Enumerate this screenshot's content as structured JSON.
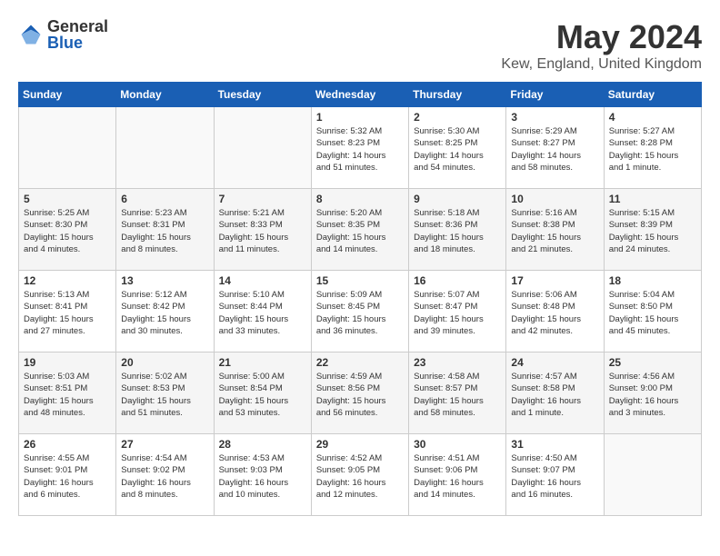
{
  "logo": {
    "general": "General",
    "blue": "Blue"
  },
  "title": {
    "month": "May 2024",
    "location": "Kew, England, United Kingdom"
  },
  "headers": [
    "Sunday",
    "Monday",
    "Tuesday",
    "Wednesday",
    "Thursday",
    "Friday",
    "Saturday"
  ],
  "weeks": [
    [
      {
        "day": "",
        "info": ""
      },
      {
        "day": "",
        "info": ""
      },
      {
        "day": "",
        "info": ""
      },
      {
        "day": "1",
        "info": "Sunrise: 5:32 AM\nSunset: 8:23 PM\nDaylight: 14 hours\nand 51 minutes."
      },
      {
        "day": "2",
        "info": "Sunrise: 5:30 AM\nSunset: 8:25 PM\nDaylight: 14 hours\nand 54 minutes."
      },
      {
        "day": "3",
        "info": "Sunrise: 5:29 AM\nSunset: 8:27 PM\nDaylight: 14 hours\nand 58 minutes."
      },
      {
        "day": "4",
        "info": "Sunrise: 5:27 AM\nSunset: 8:28 PM\nDaylight: 15 hours\nand 1 minute."
      }
    ],
    [
      {
        "day": "5",
        "info": "Sunrise: 5:25 AM\nSunset: 8:30 PM\nDaylight: 15 hours\nand 4 minutes."
      },
      {
        "day": "6",
        "info": "Sunrise: 5:23 AM\nSunset: 8:31 PM\nDaylight: 15 hours\nand 8 minutes."
      },
      {
        "day": "7",
        "info": "Sunrise: 5:21 AM\nSunset: 8:33 PM\nDaylight: 15 hours\nand 11 minutes."
      },
      {
        "day": "8",
        "info": "Sunrise: 5:20 AM\nSunset: 8:35 PM\nDaylight: 15 hours\nand 14 minutes."
      },
      {
        "day": "9",
        "info": "Sunrise: 5:18 AM\nSunset: 8:36 PM\nDaylight: 15 hours\nand 18 minutes."
      },
      {
        "day": "10",
        "info": "Sunrise: 5:16 AM\nSunset: 8:38 PM\nDaylight: 15 hours\nand 21 minutes."
      },
      {
        "day": "11",
        "info": "Sunrise: 5:15 AM\nSunset: 8:39 PM\nDaylight: 15 hours\nand 24 minutes."
      }
    ],
    [
      {
        "day": "12",
        "info": "Sunrise: 5:13 AM\nSunset: 8:41 PM\nDaylight: 15 hours\nand 27 minutes."
      },
      {
        "day": "13",
        "info": "Sunrise: 5:12 AM\nSunset: 8:42 PM\nDaylight: 15 hours\nand 30 minutes."
      },
      {
        "day": "14",
        "info": "Sunrise: 5:10 AM\nSunset: 8:44 PM\nDaylight: 15 hours\nand 33 minutes."
      },
      {
        "day": "15",
        "info": "Sunrise: 5:09 AM\nSunset: 8:45 PM\nDaylight: 15 hours\nand 36 minutes."
      },
      {
        "day": "16",
        "info": "Sunrise: 5:07 AM\nSunset: 8:47 PM\nDaylight: 15 hours\nand 39 minutes."
      },
      {
        "day": "17",
        "info": "Sunrise: 5:06 AM\nSunset: 8:48 PM\nDaylight: 15 hours\nand 42 minutes."
      },
      {
        "day": "18",
        "info": "Sunrise: 5:04 AM\nSunset: 8:50 PM\nDaylight: 15 hours\nand 45 minutes."
      }
    ],
    [
      {
        "day": "19",
        "info": "Sunrise: 5:03 AM\nSunset: 8:51 PM\nDaylight: 15 hours\nand 48 minutes."
      },
      {
        "day": "20",
        "info": "Sunrise: 5:02 AM\nSunset: 8:53 PM\nDaylight: 15 hours\nand 51 minutes."
      },
      {
        "day": "21",
        "info": "Sunrise: 5:00 AM\nSunset: 8:54 PM\nDaylight: 15 hours\nand 53 minutes."
      },
      {
        "day": "22",
        "info": "Sunrise: 4:59 AM\nSunset: 8:56 PM\nDaylight: 15 hours\nand 56 minutes."
      },
      {
        "day": "23",
        "info": "Sunrise: 4:58 AM\nSunset: 8:57 PM\nDaylight: 15 hours\nand 58 minutes."
      },
      {
        "day": "24",
        "info": "Sunrise: 4:57 AM\nSunset: 8:58 PM\nDaylight: 16 hours\nand 1 minute."
      },
      {
        "day": "25",
        "info": "Sunrise: 4:56 AM\nSunset: 9:00 PM\nDaylight: 16 hours\nand 3 minutes."
      }
    ],
    [
      {
        "day": "26",
        "info": "Sunrise: 4:55 AM\nSunset: 9:01 PM\nDaylight: 16 hours\nand 6 minutes."
      },
      {
        "day": "27",
        "info": "Sunrise: 4:54 AM\nSunset: 9:02 PM\nDaylight: 16 hours\nand 8 minutes."
      },
      {
        "day": "28",
        "info": "Sunrise: 4:53 AM\nSunset: 9:03 PM\nDaylight: 16 hours\nand 10 minutes."
      },
      {
        "day": "29",
        "info": "Sunrise: 4:52 AM\nSunset: 9:05 PM\nDaylight: 16 hours\nand 12 minutes."
      },
      {
        "day": "30",
        "info": "Sunrise: 4:51 AM\nSunset: 9:06 PM\nDaylight: 16 hours\nand 14 minutes."
      },
      {
        "day": "31",
        "info": "Sunrise: 4:50 AM\nSunset: 9:07 PM\nDaylight: 16 hours\nand 16 minutes."
      },
      {
        "day": "",
        "info": ""
      }
    ]
  ]
}
